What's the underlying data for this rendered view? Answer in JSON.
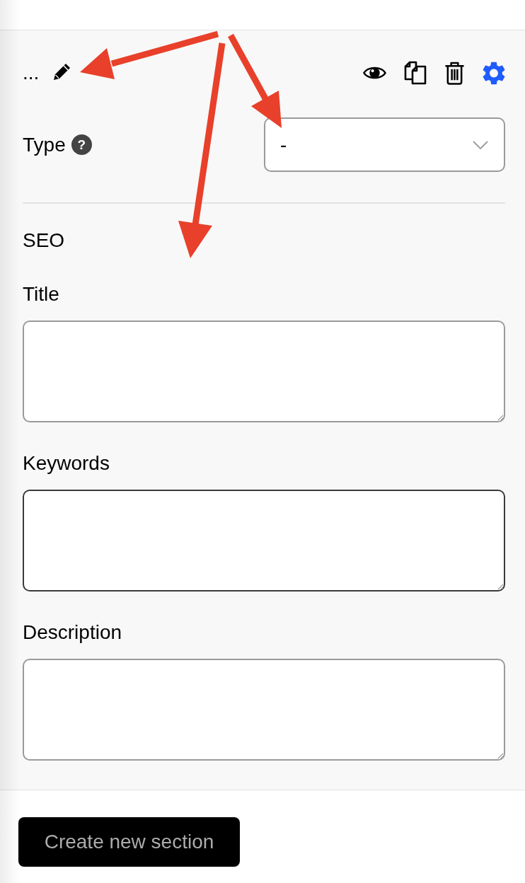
{
  "header": {
    "title": "...",
    "tools": [
      {
        "kind": "preview",
        "selected": false
      },
      {
        "kind": "duplicate",
        "selected": false
      },
      {
        "kind": "delete",
        "selected": false
      },
      {
        "kind": "settings",
        "selected": true
      }
    ]
  },
  "type_field": {
    "label": "Type",
    "help": "?",
    "value": "-"
  },
  "seo": {
    "heading": "SEO",
    "fields": [
      {
        "label": "Title",
        "focused": false
      },
      {
        "label": "Keywords",
        "focused": true
      },
      {
        "label": "Description",
        "focused": false
      }
    ]
  },
  "create_button": {
    "label": "Create new section",
    "disabled": true
  }
}
